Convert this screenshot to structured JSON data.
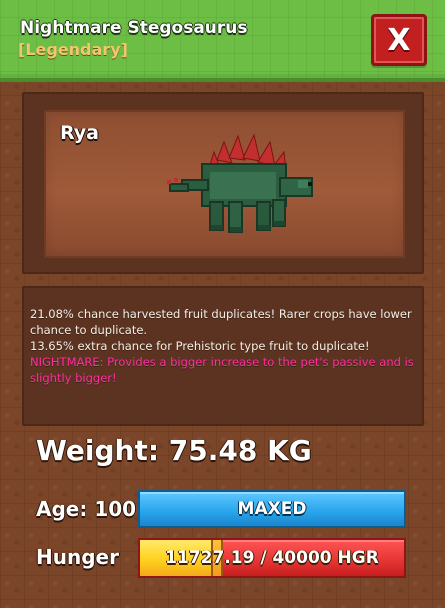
{
  "header": {
    "title": "Nightmare Stegosaurus",
    "rarity": "[Legendary]",
    "close_label": "X"
  },
  "display": {
    "variant": "Rya"
  },
  "description": {
    "line1": "21.08% chance harvested fruit duplicates! Rarer crops have lower chance to duplicate.",
    "line2": "13.65% extra chance for Prehistoric type fruit to duplicate!",
    "line3": "NIGHTMARE: Provides a bigger increase to the pet's passive and is slightly bigger!"
  },
  "stats": {
    "weight": "Weight: 75.48 KG",
    "age_label": "Age: 100",
    "age_status": "MAXED",
    "hunger_label": "Hunger",
    "hunger_value": "11727.19 / 40000 HGR",
    "hunger_fraction": 0.293
  },
  "colors": {
    "header_green": "#6cbe45",
    "close_red": "#c21f20",
    "rarity_gold": "#f0c76e",
    "age_blue": "#27a4ea",
    "hunger_red": "#e53333",
    "hunger_yellow": "#ffd11e",
    "nightmare_magenta": "#ff2ea1"
  },
  "icons": {
    "close": "close-icon",
    "pet": "stegosaurus-icon"
  }
}
